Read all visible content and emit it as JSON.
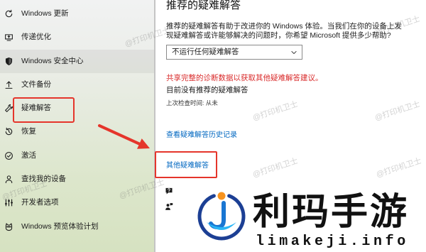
{
  "sidebar": {
    "items": [
      {
        "label": "Windows 更新",
        "icon": "refresh-icon"
      },
      {
        "label": "传递优化",
        "icon": "delivery-optimization-icon"
      },
      {
        "label": "Windows 安全中心",
        "icon": "shield-icon",
        "hovered": true
      },
      {
        "label": "文件备份",
        "icon": "backup-upload-icon"
      },
      {
        "label": "疑难解答",
        "icon": "wrench-icon",
        "annotated": true
      },
      {
        "label": "恢复",
        "icon": "recovery-icon"
      },
      {
        "label": "激活",
        "icon": "check-circle-icon"
      },
      {
        "label": "查找我的设备",
        "icon": "find-device-icon"
      },
      {
        "label": "开发者选项",
        "icon": "developer-bars-icon"
      },
      {
        "label": "Windows 预览体验计划",
        "icon": "insider-cat-icon"
      }
    ]
  },
  "main": {
    "title": "推荐的疑难解答",
    "description": "推荐的疑难解答有助于改进你的 Windows 体验。当我们在你的设备上发现疑难解答或许能够解决的问题时，你希望 Microsoft 提供多少帮助?",
    "dropdown": {
      "selected": "不运行任何疑难解答",
      "icon": "chevron-down-icon"
    },
    "diagnostic_warning": "共享完整的诊断数据以获取其他疑难解答建议。",
    "status": "目前没有推荐的疑难解答",
    "last_checked": "上次检查时间: 从未",
    "history_link": "查看疑难解答历史记录",
    "other_troubleshooters_link": "其他疑难解答",
    "footer_icons": [
      "get-help-icon",
      "feedback-icon"
    ]
  },
  "annotations": {
    "arrow_icon": "red-arrow-icon",
    "color": "#e5352b"
  },
  "watermark": {
    "text": "@打印机卫士"
  },
  "logo": {
    "title": "利玛手游",
    "domain": "limakeji.info"
  },
  "colors": {
    "link": "#0067c0",
    "warning": "#d92b2b",
    "text": "#1b1b1b",
    "divider": "#c4c4c4",
    "logo_navy": "#1c3f94",
    "logo_orange": "#f7931e",
    "logo_blue": "#1976d2",
    "logo_cyan": "#29b6f6"
  }
}
